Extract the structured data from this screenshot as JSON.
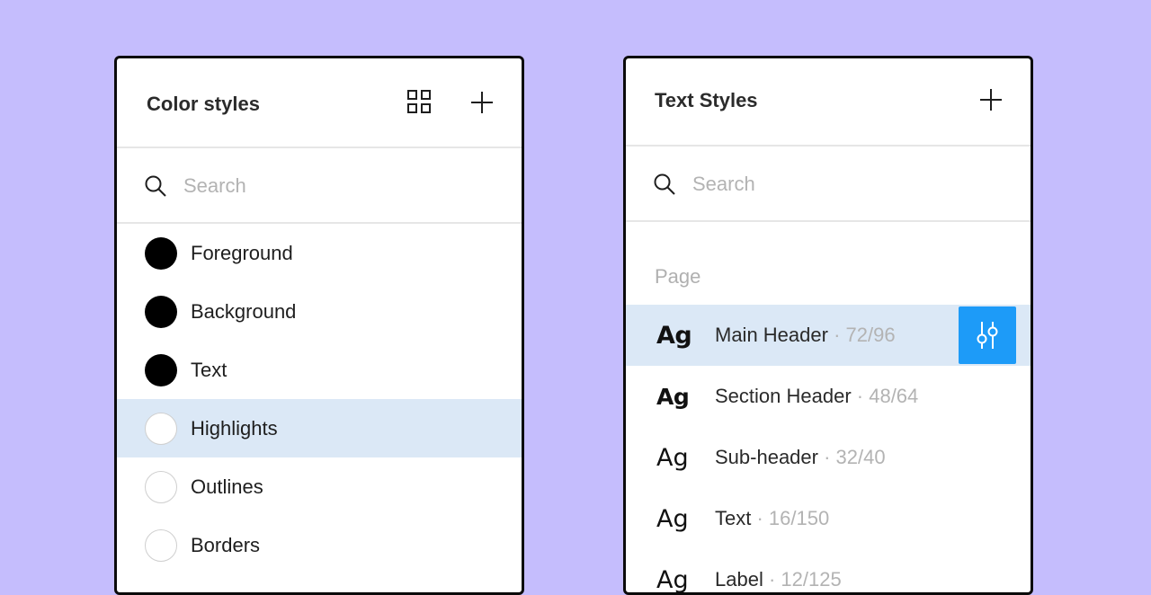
{
  "color_styles": {
    "title": "Color styles",
    "grid_icon": "grid-view-icon",
    "add_icon": "plus-icon",
    "search": {
      "placeholder": "Search",
      "icon": "search-icon"
    },
    "items": [
      {
        "label": "Foreground",
        "swatch": "#000000",
        "selected": false
      },
      {
        "label": "Background",
        "swatch": "#000000",
        "selected": false
      },
      {
        "label": "Text",
        "swatch": "#000000",
        "selected": false
      },
      {
        "label": "Highlights",
        "swatch": "#ffffff",
        "selected": true
      },
      {
        "label": "Outlines",
        "swatch": "#ffffff",
        "selected": false
      },
      {
        "label": "Borders",
        "swatch": "#ffffff",
        "selected": false
      }
    ]
  },
  "text_styles": {
    "title": "Text Styles",
    "add_icon": "plus-icon",
    "search": {
      "placeholder": "Search",
      "icon": "search-icon"
    },
    "group_label": "Page",
    "sample": "Ag",
    "separator": " · ",
    "edit_icon": "sliders-icon",
    "items": [
      {
        "name": "Main Header",
        "size": "72/96",
        "selected": true
      },
      {
        "name": "Section Header",
        "size": "48/64",
        "selected": false
      },
      {
        "name": "Sub-header",
        "size": "32/40",
        "selected": false
      },
      {
        "name": "Text",
        "size": "16/150",
        "selected": false
      },
      {
        "name": "Label",
        "size": "12/125",
        "selected": false
      }
    ]
  },
  "colors": {
    "background": "#c5bdfd",
    "selection": "#dbe8f6",
    "accent": "#1d9bf8",
    "muted_text": "#b3b3b3"
  }
}
